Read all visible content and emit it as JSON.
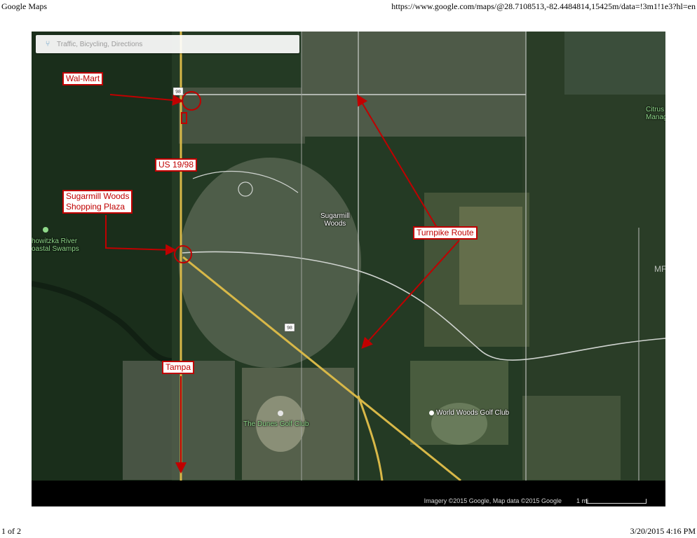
{
  "header": {
    "title": "Google Maps",
    "url": "https://www.google.com/maps/@28.7108513,-82.4484814,15425m/data=!3m1!1e3?hl=en"
  },
  "footer": {
    "page": "1 of 2",
    "datetime": "3/20/2015 4:16 PM"
  },
  "map": {
    "search_placeholder": "Traffic, Bicycling, Directions",
    "attribution": "Imagery ©2015 Google, Map data ©2015 Google",
    "scale_label": "1 mi",
    "watermark": "MFRMLS",
    "colors": {
      "annotation": "#c00000",
      "highway": "#d8b848",
      "road": "#cfd3cf"
    },
    "labels": {
      "sugarmill_woods_line1": "Sugarmill",
      "sugarmill_woods_line2": "Woods",
      "citrus_line1": "Citrus",
      "citrus_line2": "Manage",
      "chassahowitzka_line1": "howitzka River",
      "chassahowitzka_line2": "oastal Swamps",
      "dunes_golf": "The Dunes Golf Club",
      "world_woods": "World Woods Golf Club",
      "route_shield": "98"
    },
    "callouts": {
      "walmart": "Wal-Mart",
      "us19": "US 19/98",
      "plaza_line1": "Sugarmill Woods",
      "plaza_line2": "Shopping Plaza",
      "turnpike": "Turnpike Route",
      "tampa": "Tampa"
    }
  }
}
